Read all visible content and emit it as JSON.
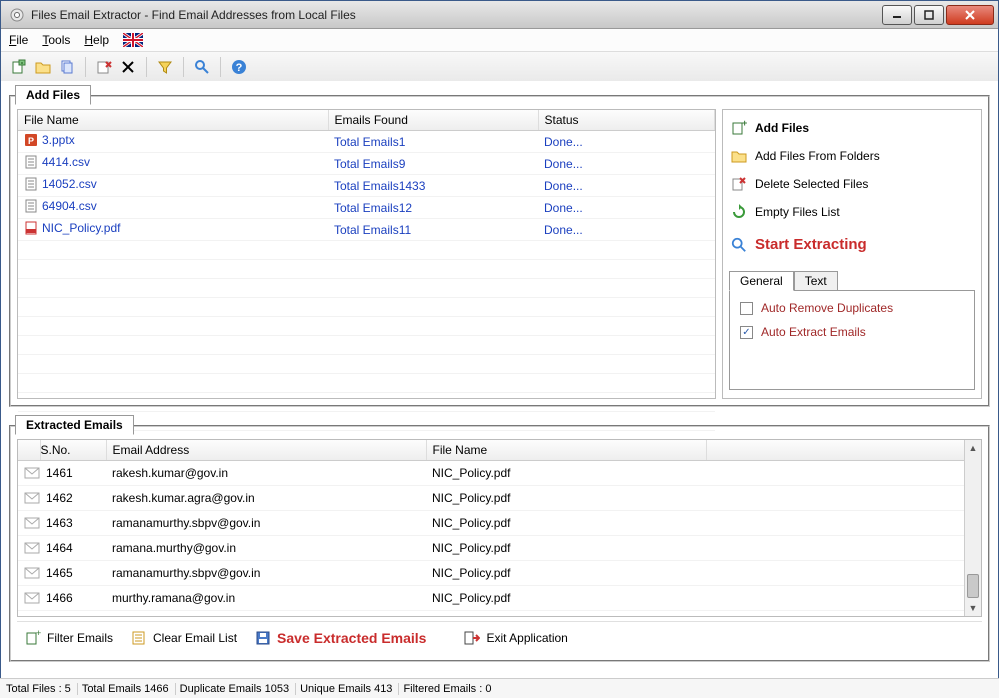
{
  "title": "Files Email Extractor -   Find Email Addresses from Local Files",
  "menu": {
    "file": "File",
    "tools": "Tools",
    "help": "Help"
  },
  "tabs": {
    "add_files": "Add Files",
    "extracted_emails": "Extracted Emails"
  },
  "headers": {
    "files": {
      "name": "File Name",
      "emails": "Emails Found",
      "status": "Status"
    },
    "emails": {
      "sno": "S.No.",
      "email": "Email Address",
      "file": "File Name"
    }
  },
  "files": [
    {
      "icon": "ppt",
      "name": "3.pptx",
      "emails": "Total Emails1",
      "status": "Done..."
    },
    {
      "icon": "csv",
      "name": "4414.csv",
      "emails": "Total Emails9",
      "status": "Done..."
    },
    {
      "icon": "csv",
      "name": "14052.csv",
      "emails": "Total Emails1433",
      "status": "Done..."
    },
    {
      "icon": "csv",
      "name": "64904.csv",
      "emails": "Total Emails12",
      "status": "Done..."
    },
    {
      "icon": "pdf",
      "name": "NIC_Policy.pdf",
      "emails": "Total Emails11",
      "status": "Done..."
    }
  ],
  "side": {
    "add_files": "Add Files",
    "add_from_folders": "Add Files From Folders",
    "delete_selected": "Delete Selected Files",
    "empty_list": "Empty Files List",
    "start_extracting": "Start Extracting",
    "tab_general": "General",
    "tab_text": "Text",
    "auto_remove_dup": "Auto Remove Duplicates",
    "auto_extract": "Auto Extract Emails"
  },
  "emails": [
    {
      "sno": "1461",
      "email": "rakesh.kumar@gov.in",
      "file": "NIC_Policy.pdf"
    },
    {
      "sno": "1462",
      "email": "rakesh.kumar.agra@gov.in",
      "file": "NIC_Policy.pdf"
    },
    {
      "sno": "1463",
      "email": "ramanamurthy.sbpv@gov.in",
      "file": "NIC_Policy.pdf"
    },
    {
      "sno": "1464",
      "email": "ramana.murthy@gov.in",
      "file": "NIC_Policy.pdf"
    },
    {
      "sno": "1465",
      "email": "ramanamurthy.sbpv@gov.in",
      "file": "NIC_Policy.pdf"
    },
    {
      "sno": "1466",
      "email": "murthy.ramana@gov.in",
      "file": "NIC_Policy.pdf"
    }
  ],
  "buttons": {
    "filter_emails": "Filter Emails",
    "clear_email_list": "Clear Email List",
    "save_extracted": "Save Extracted Emails",
    "exit_app": "Exit Application"
  },
  "status": {
    "total_files": "Total Files :  5",
    "total_emails": "Total Emails  1466",
    "dup_emails": "Duplicate Emails  1053",
    "unique_emails": "Unique Emails  413",
    "filtered_emails": "Filtered Emails :  0"
  }
}
